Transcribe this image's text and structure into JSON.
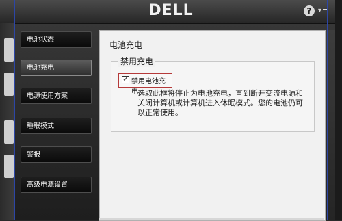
{
  "header": {
    "logo": "DELL",
    "help_icon": "?",
    "menu_icon": "▾"
  },
  "nav": {
    "items": [
      {
        "label": "电池状态"
      },
      {
        "label": "电池充电"
      },
      {
        "label": "电源使用方案"
      },
      {
        "label": "睡眠模式"
      },
      {
        "label": "警报"
      },
      {
        "label": "高级电源设置"
      }
    ]
  },
  "content": {
    "title": "电池充电",
    "group_title": "禁用充电",
    "checkbox_label": "禁用电池充电",
    "description": "选取此框将停止为电池充电，直到断开交流电源和关闭计算机或计算机进入休眠模式。您的电池仍可以正常使用。"
  }
}
